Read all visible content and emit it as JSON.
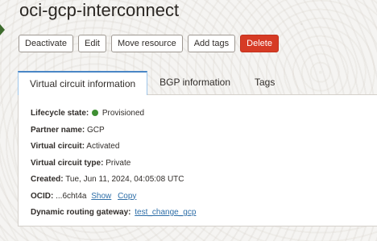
{
  "page": {
    "title": "oci-gcp-interconnect"
  },
  "actions": {
    "deactivate": "Deactivate",
    "edit": "Edit",
    "move_resource": "Move resource",
    "add_tags": "Add tags",
    "delete": "Delete"
  },
  "tabs": {
    "virtual_circuit_information": "Virtual circuit information",
    "bgp_information": "BGP information",
    "tags": "Tags"
  },
  "details": {
    "lifecycle_state": {
      "label": "Lifecycle state:",
      "value": "Provisioned",
      "status_color": "#3f8f33"
    },
    "partner_name": {
      "label": "Partner name:",
      "value": "GCP"
    },
    "virtual_circuit": {
      "label": "Virtual circuit:",
      "value": "Activated"
    },
    "virtual_circuit_type": {
      "label": "Virtual circuit type:",
      "value": "Private"
    },
    "created": {
      "label": "Created:",
      "value": "Tue, Jun 11, 2024, 04:05:08 UTC"
    },
    "ocid": {
      "label": "OCID:",
      "value": "...6cht4a",
      "show": "Show",
      "copy": "Copy"
    },
    "dynamic_routing_gateway": {
      "label": "Dynamic routing gateway:",
      "value": "test_change_gcp"
    }
  },
  "colors": {
    "accent": "#4a86c5",
    "danger": "#d63b25",
    "link": "#2f6fa8",
    "status_ok": "#3f8f33"
  }
}
